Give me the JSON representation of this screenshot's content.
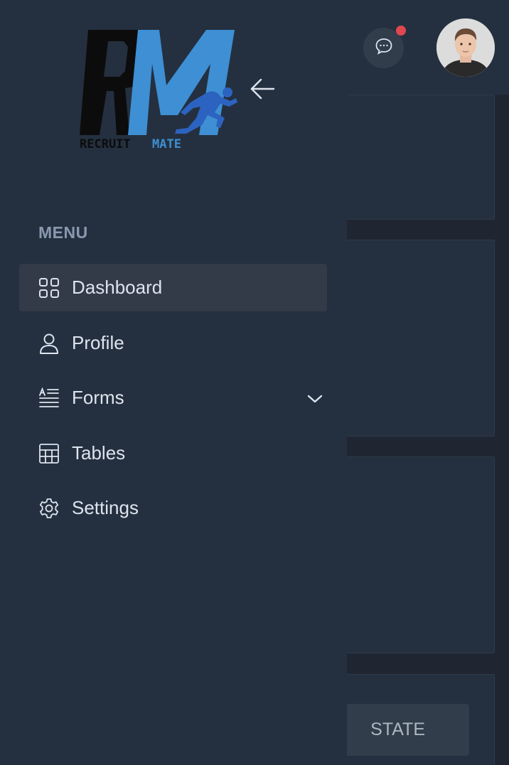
{
  "brand": {
    "logo_text_dark": "RECRUIT",
    "logo_text_light": "MATE"
  },
  "sidebar": {
    "menu_title": "MENU",
    "items": [
      {
        "label": "Dashboard",
        "icon": "grid-icon",
        "active": true
      },
      {
        "label": "Profile",
        "icon": "user-icon"
      },
      {
        "label": "Forms",
        "icon": "form-icon",
        "has_dropdown": true
      },
      {
        "label": "Tables",
        "icon": "table-icon"
      },
      {
        "label": "Settings",
        "icon": "gear-icon"
      }
    ]
  },
  "main": {
    "state_button_label": "STATE"
  },
  "colors": {
    "sidebar_bg": "#24303f",
    "active_item_bg": "#333a48",
    "notification_dot": "#e04851",
    "logo_blue": "#3e8fd4"
  }
}
